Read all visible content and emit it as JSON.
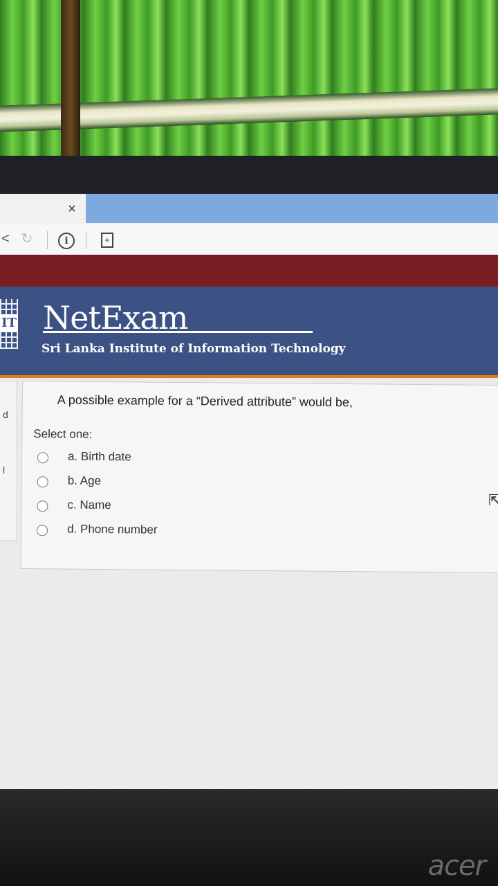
{
  "browser": {
    "close_tab_glyph": "×",
    "info_glyph": "i",
    "page_glyph": "+",
    "back_glyph": "<",
    "reload_glyph": "↻"
  },
  "header": {
    "title": "NetExam",
    "subtitle": "Sri Lanka Institute of Information Technology",
    "logo_text": "IT"
  },
  "side_panel": {
    "letters": [
      "d",
      "l"
    ]
  },
  "question": {
    "text": "A possible example for a “Derived attribute” would be,",
    "select_label": "Select one:",
    "options": [
      {
        "label": "a. Birth date",
        "selected": false
      },
      {
        "label": "b. Age",
        "selected": false
      },
      {
        "label": "c. Name",
        "selected": false
      },
      {
        "label": "d. Phone number",
        "selected": false
      }
    ]
  },
  "device": {
    "brand": "acer"
  },
  "colors": {
    "header_bg": "#3c5285",
    "header_accent": "#e07a1f",
    "maroon_band": "#7a1e24",
    "active_tab": "#7ea9e0"
  }
}
